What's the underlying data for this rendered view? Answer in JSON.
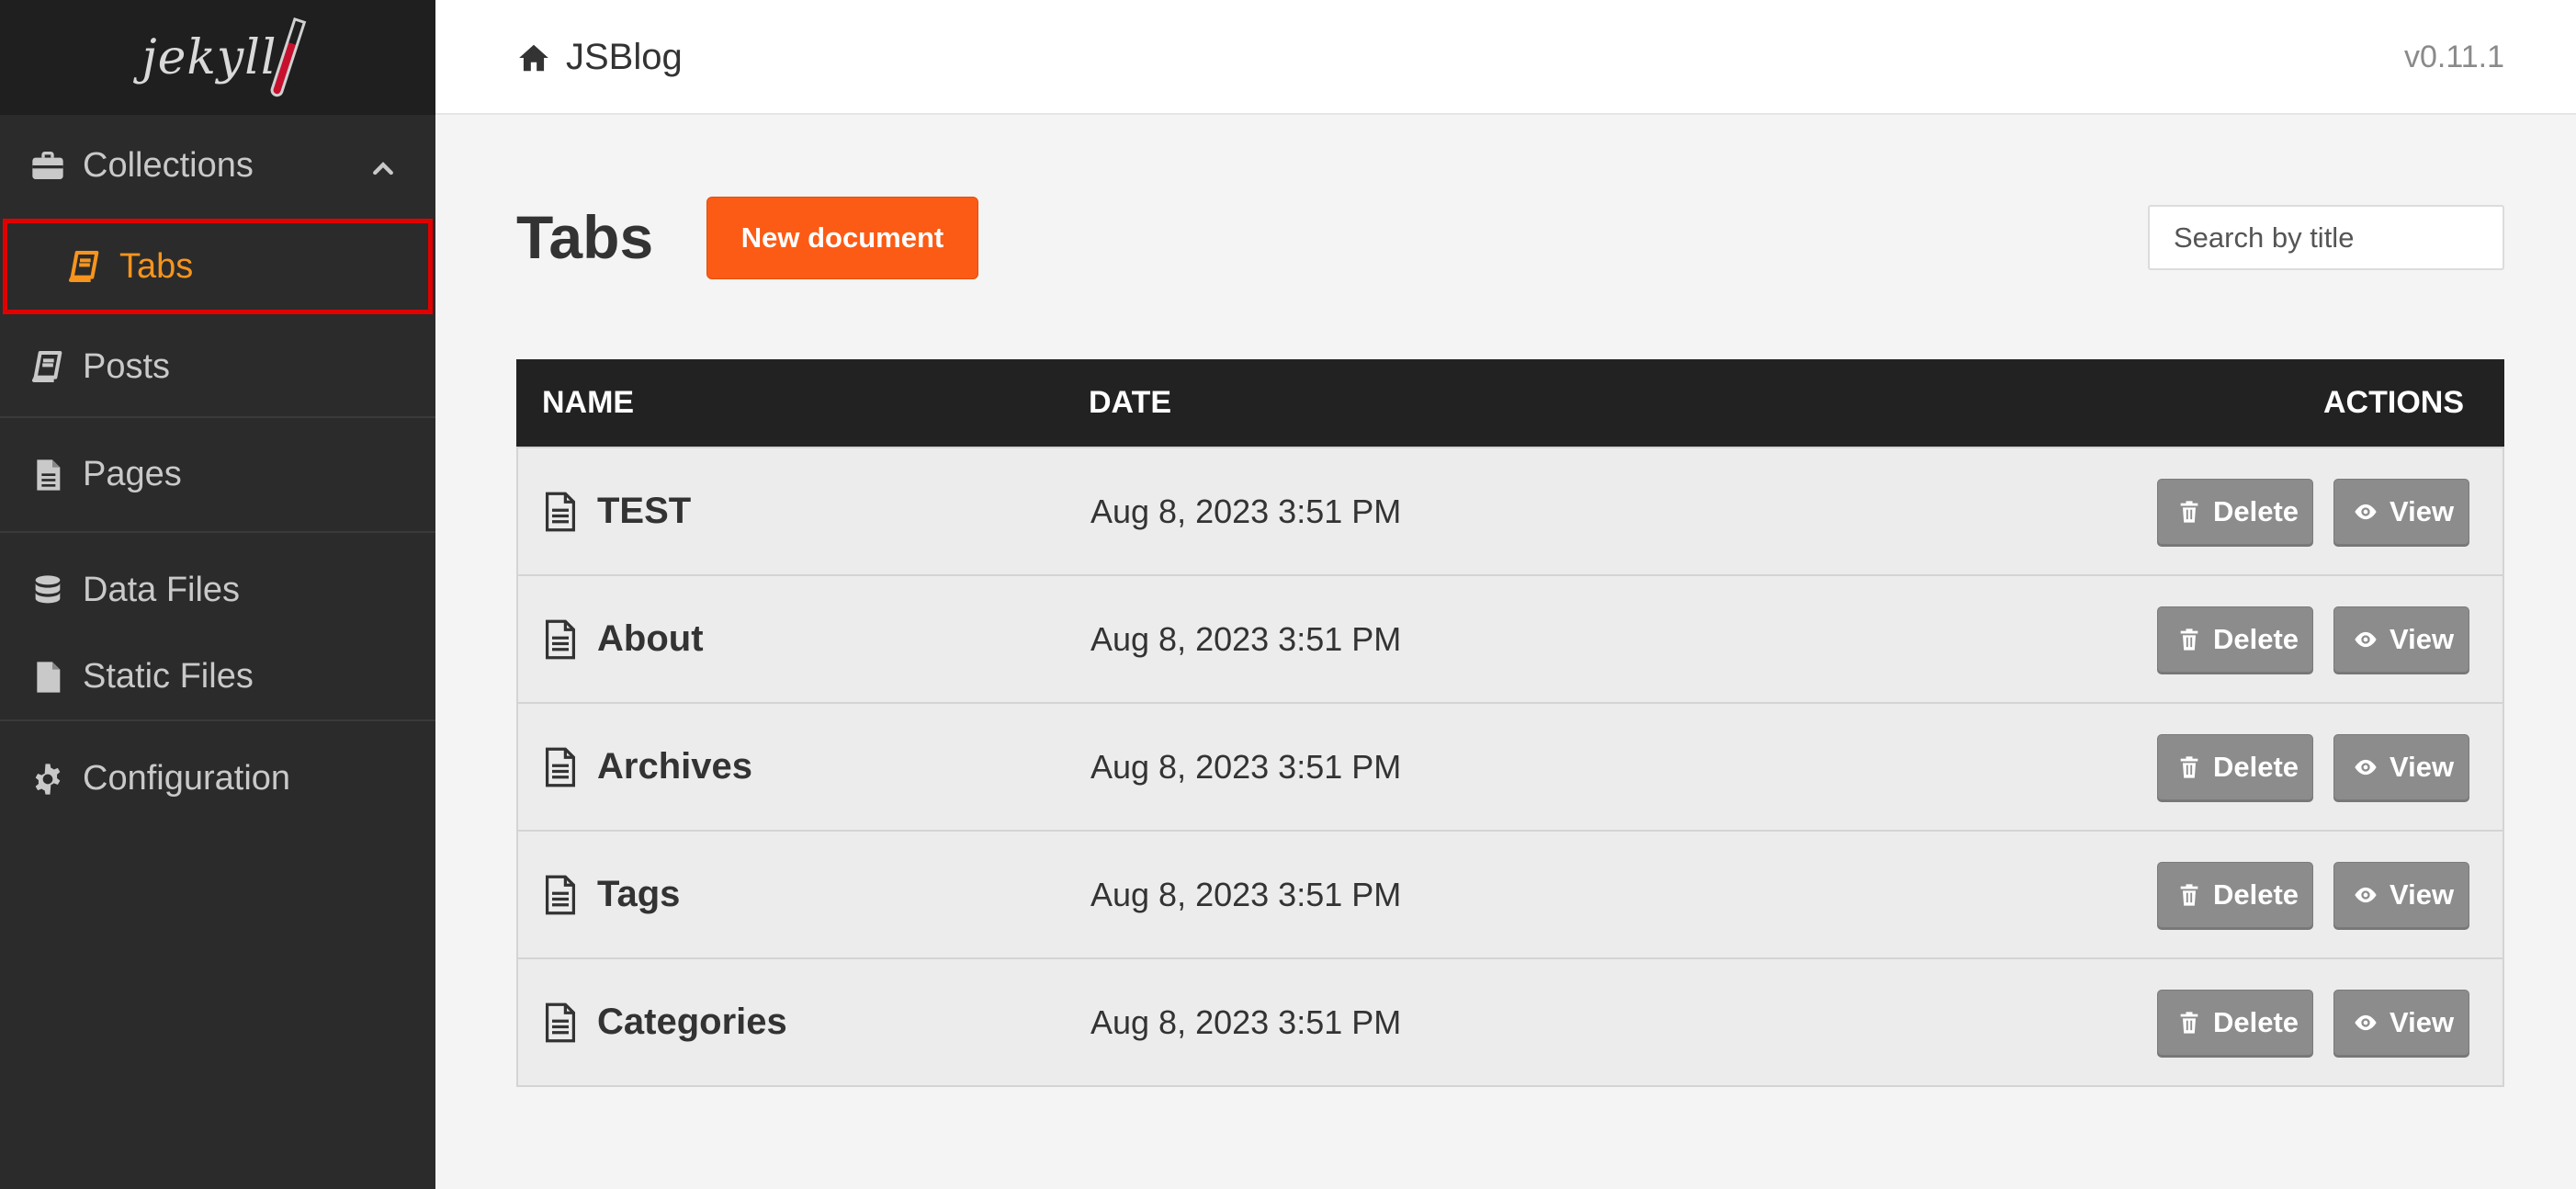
{
  "brand": {
    "logo_text": "jekyll",
    "logo_icon": "test-tube-icon"
  },
  "header": {
    "site_title": "JSBlog",
    "site_icon": "home-icon",
    "version": "v0.11.1"
  },
  "sidebar": {
    "items": [
      {
        "label": "Collections",
        "icon": "briefcase-icon",
        "expanded": true
      },
      {
        "label": "Tabs",
        "icon": "book-icon",
        "active": true
      },
      {
        "label": "Posts",
        "icon": "book-icon"
      },
      {
        "label": "Pages",
        "icon": "file-text-icon"
      },
      {
        "label": "Data Files",
        "icon": "database-icon"
      },
      {
        "label": "Static Files",
        "icon": "file-icon"
      },
      {
        "label": "Configuration",
        "icon": "gear-icon"
      }
    ]
  },
  "main": {
    "title": "Tabs",
    "new_document_label": "New document",
    "search_placeholder": "Search by title",
    "table": {
      "headers": {
        "name": "NAME",
        "date": "DATE",
        "actions": "ACTIONS"
      },
      "rows": [
        {
          "name": "TEST",
          "date": "Aug 8, 2023 3:51 PM"
        },
        {
          "name": "About",
          "date": "Aug 8, 2023 3:51 PM"
        },
        {
          "name": "Archives",
          "date": "Aug 8, 2023 3:51 PM"
        },
        {
          "name": "Tags",
          "date": "Aug 8, 2023 3:51 PM"
        },
        {
          "name": "Categories",
          "date": "Aug 8, 2023 3:51 PM"
        }
      ],
      "delete_label": "Delete",
      "view_label": "View"
    }
  },
  "colors": {
    "accent": "#fc5b15",
    "active_nav": "#f7941d",
    "highlight_outline": "#e00000",
    "sidebar_bg": "#2b2b2b",
    "table_header_bg": "#222222",
    "action_button_bg": "#8c8c8c"
  }
}
